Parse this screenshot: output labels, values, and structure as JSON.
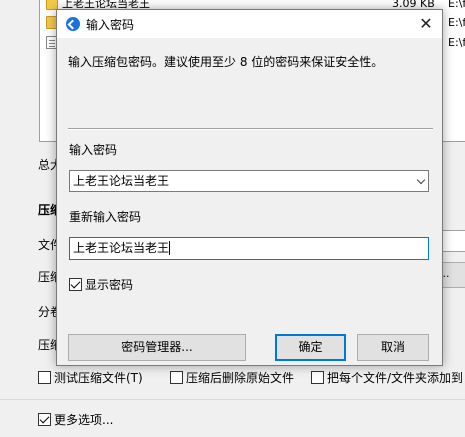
{
  "background": {
    "files": [
      {
        "icon": "folder-icon",
        "name": "上老王论坛当老王",
        "size": "3.09 KB",
        "path": "E:\\f"
      },
      {
        "icon": "folder-icon",
        "name": "",
        "size": "",
        "path": "E:\\f"
      },
      {
        "icon": "document-icon",
        "name": "",
        "size": "",
        "path": "E:\\f"
      }
    ],
    "labels": {
      "total": "总大",
      "compression": "压缩",
      "file": "文件",
      "compression2": "压缩",
      "split": "分卷",
      "compression3": "压缩"
    },
    "side_button_label": "...",
    "checks": [
      {
        "label": "测试压缩文件(T)",
        "checked": false
      },
      {
        "label": "压缩后删除原始文件",
        "checked": false
      },
      {
        "label": "把每个文件/文件夹添加到",
        "checked": false
      }
    ],
    "more_options": {
      "label": "更多选项...",
      "checked": true
    }
  },
  "dialog": {
    "title": "输入密码",
    "close_glyph": "✕",
    "description": "输入压缩包密码。建议使用至少 8 位的密码来保证安全性。",
    "password_label": "输入密码",
    "password_value": "上老王论坛当老王",
    "confirm_label": "重新输入密码",
    "confirm_value": "上老王论坛当老王",
    "show_password": {
      "label": "显示密码",
      "checked": true
    },
    "buttons": {
      "manager": "密码管理器...",
      "ok": "确定",
      "cancel": "取消"
    }
  },
  "colors": {
    "accent": "#0078d7",
    "title_icon": "#1a73d9"
  }
}
